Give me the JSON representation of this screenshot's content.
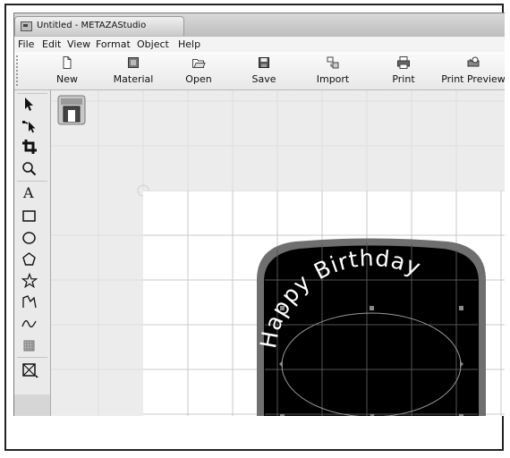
{
  "window": {
    "title": "Untitled - METAZAStudio"
  },
  "menu": [
    "File",
    "Edit",
    "View",
    "Format",
    "Object",
    "Help"
  ],
  "toolbar": {
    "buttons": [
      {
        "label": "New",
        "icon": "new-document-icon"
      },
      {
        "label": "Material",
        "icon": "material-icon"
      },
      {
        "label": "Open",
        "icon": "open-folder-icon"
      },
      {
        "label": "Save",
        "icon": "save-disk-icon"
      },
      {
        "label": "Import",
        "icon": "import-icon"
      },
      {
        "label": "Print",
        "icon": "printer-icon"
      },
      {
        "label": "Print Preview",
        "icon": "print-preview-icon"
      }
    ]
  },
  "tools": [
    "select-arrow-icon",
    "node-select-icon",
    "crop-icon",
    "zoom-icon",
    "text-tool-icon",
    "rectangle-icon",
    "ellipse-icon",
    "polygon-icon",
    "star-icon",
    "polyline-icon",
    "freehand-icon",
    "fill-pattern-icon",
    "image-frame-icon"
  ],
  "tools_text": {
    "text_tool": "A"
  },
  "design": {
    "arc_text": "Happy Birthday",
    "plate_color": "#000000",
    "border_color": "#6f6f6f"
  }
}
